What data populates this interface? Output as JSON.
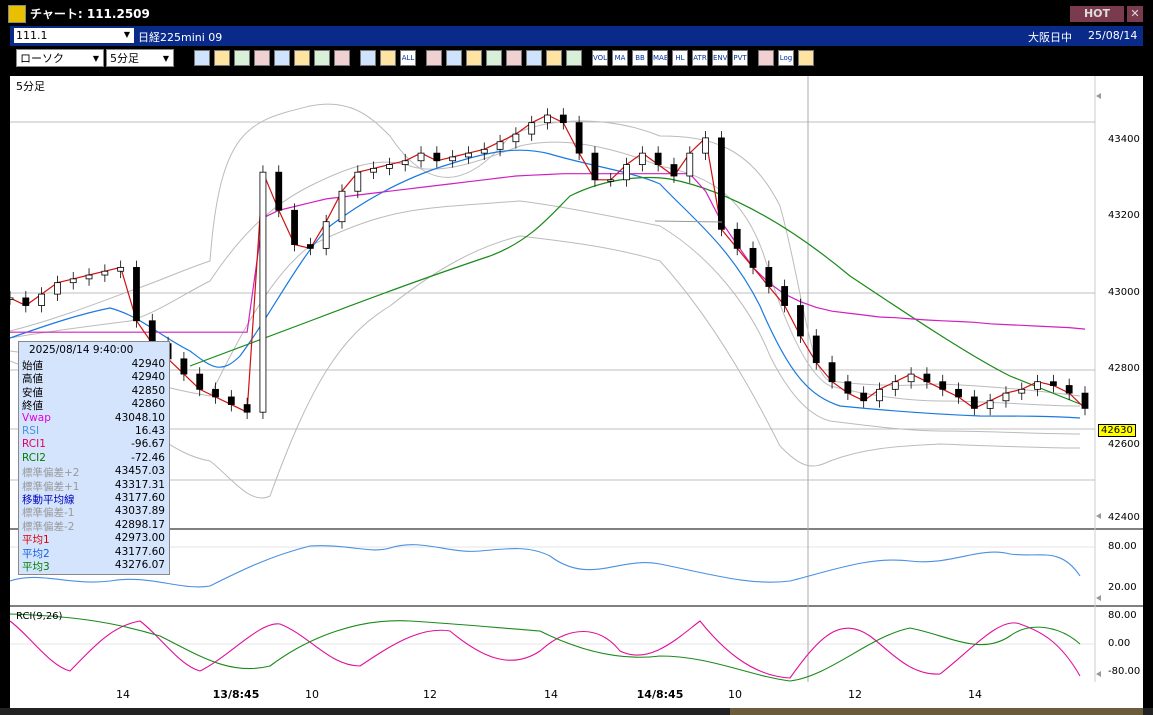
{
  "window": {
    "title": "チャート: 111.2509",
    "hot_label": "HOT",
    "close_glyph": "✕"
  },
  "infobar": {
    "symbol_code": "111.1",
    "symbol_name": "日経225mini 09",
    "session": "大阪日中",
    "date": "25/08/14"
  },
  "toolbar": {
    "chart_type": "ローソク",
    "timeframe": "5分足",
    "buttons": [
      "zoom-icon",
      "window-icon",
      "draw-line-icon",
      "pencil-icon",
      "cursor-icon",
      "undo-icon",
      "memo-icon",
      "trash-icon",
      "bar-chart-icon",
      "bar-chart2-icon",
      "ALL",
      "alert-icon",
      "target-icon",
      "chart-icon",
      "sort-icon",
      "settings-icon",
      "tools-icon",
      "wrench-icon",
      "palette-icon",
      "VOL",
      "MA",
      "BB",
      "MAE",
      "HL",
      "ATR",
      "ENV",
      "PVT",
      "window2-icon",
      "Log",
      "export-icon"
    ]
  },
  "chart": {
    "timeframe_label": "5分足",
    "price_labels": [
      "43400",
      "43200",
      "43000",
      "42800",
      "42600",
      "42400"
    ],
    "last_price": "42630",
    "rsi_labels": [
      "80.00",
      "20.00"
    ],
    "rci_labels": [
      "80.00",
      "0.00",
      "-80.00"
    ],
    "rci_title": "RCI(9,26)",
    "x_labels": [
      {
        "text": "14",
        "bold": false
      },
      {
        "text": "13/8:45",
        "bold": true
      },
      {
        "text": "10",
        "bold": false
      },
      {
        "text": "12",
        "bold": false
      },
      {
        "text": "14",
        "bold": false
      },
      {
        "text": "14/8:45",
        "bold": true
      },
      {
        "text": "10",
        "bold": false
      },
      {
        "text": "12",
        "bold": false
      },
      {
        "text": "14",
        "bold": false
      }
    ]
  },
  "infobox": {
    "timestamp": "2025/08/14  9:40:00",
    "rows": [
      {
        "k": "始値",
        "v": "42940",
        "color": "#000000"
      },
      {
        "k": "高値",
        "v": "42940",
        "color": "#000000"
      },
      {
        "k": "安値",
        "v": "42850",
        "color": "#000000"
      },
      {
        "k": "終値",
        "v": "42860",
        "color": "#000000"
      },
      {
        "k": "Vwap",
        "v": "43048.10",
        "color": "#e000e0"
      },
      {
        "k": "RSI",
        "v": "16.43",
        "color": "#4a90e2"
      },
      {
        "k": "RCI1",
        "v": "-96.67",
        "color": "#e00060"
      },
      {
        "k": "RCI2",
        "v": "-72.46",
        "color": "#008000"
      },
      {
        "k": "標準偏差+2",
        "v": "43457.03",
        "color": "#999999"
      },
      {
        "k": "標準偏差+1",
        "v": "43317.31",
        "color": "#999999"
      },
      {
        "k": "移動平均線",
        "v": "43177.60",
        "color": "#0000c0"
      },
      {
        "k": "標準偏差-1",
        "v": "43037.89",
        "color": "#999999"
      },
      {
        "k": "標準偏差-2",
        "v": "42898.17",
        "color": "#999999"
      },
      {
        "k": "平均1",
        "v": "42973.00",
        "color": "#e00000"
      },
      {
        "k": "平均2",
        "v": "43177.60",
        "color": "#1060e0"
      },
      {
        "k": "平均3",
        "v": "43276.07",
        "color": "#008000"
      }
    ]
  },
  "chart_data": {
    "type": "line",
    "title": "",
    "ylim": [
      42400,
      43450
    ],
    "x": [
      0,
      4,
      8,
      12,
      16,
      20,
      24,
      28,
      32,
      36,
      40,
      44,
      48,
      52,
      56,
      60,
      64,
      68,
      72,
      76,
      80,
      84,
      88,
      92,
      96,
      100,
      104,
      108,
      112,
      116,
      120,
      124,
      128,
      132,
      136,
      140,
      144,
      148,
      152,
      156,
      160,
      164,
      168,
      172,
      176,
      180,
      184,
      188,
      192,
      196,
      200,
      204,
      208,
      212,
      216,
      220,
      224,
      228,
      232,
      236,
      240,
      244,
      248,
      252,
      256,
      260,
      264,
      268,
      272
    ],
    "series": [
      {
        "name": "close",
        "values": [
          42920,
          42900,
          42930,
          42960,
          42970,
          42980,
          42990,
          43000,
          42860,
          42800,
          42760,
          42720,
          42680,
          42660,
          42640,
          42620,
          43250,
          43150,
          43060,
          43050,
          43120,
          43200,
          43250,
          43260,
          43270,
          43280,
          43300,
          43280,
          43290,
          43300,
          43310,
          43330,
          43350,
          43380,
          43400,
          43380,
          43300,
          43230,
          43230,
          43270,
          43300,
          43270,
          43240,
          43300,
          43340,
          43100,
          43050,
          43000,
          42950,
          42900,
          42820,
          42750,
          42700,
          42670,
          42650,
          42680,
          42700,
          42720,
          42700,
          42680,
          42660,
          42630,
          42650,
          42670,
          42680,
          42700,
          42690,
          42670,
          42630
        ]
      },
      {
        "name": "VWAP",
        "values": [
          42830,
          42830,
          42830,
          42830,
          42830,
          42830,
          42830,
          42830,
          42830,
          42830,
          42830,
          42830,
          42830,
          42830,
          42830,
          42830,
          43130,
          43150,
          43160,
          43170,
          43180,
          43185,
          43190,
          43195,
          43200,
          43205,
          43210,
          43215,
          43220,
          43225,
          43230,
          43235,
          43240,
          43242,
          43244,
          43246,
          43246,
          43246,
          43246,
          43246,
          43246,
          43246,
          43246,
          43246,
          43200,
          43120,
          43060,
          43000,
          42960,
          42930,
          42910,
          42895,
          42885,
          42880,
          42875,
          42870,
          42868,
          42865,
          42862,
          42860,
          42858,
          42856,
          42852,
          42850,
          42848,
          42846,
          42844,
          42842,
          42838
        ]
      }
    ]
  }
}
